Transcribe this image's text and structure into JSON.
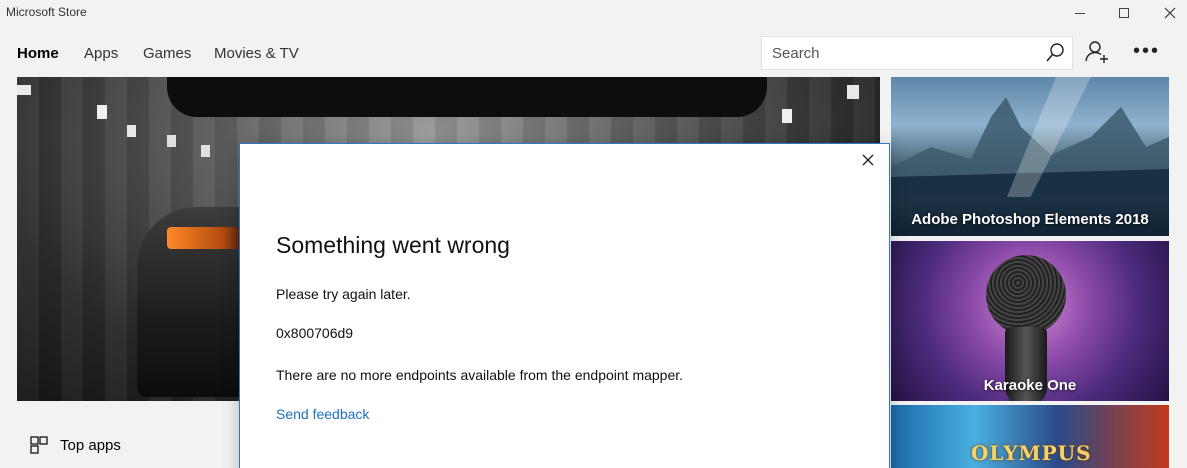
{
  "window": {
    "title": "Microsoft Store"
  },
  "nav": {
    "items": [
      {
        "label": "Home",
        "active": true
      },
      {
        "label": "Apps",
        "active": false
      },
      {
        "label": "Games",
        "active": false
      },
      {
        "label": "Movies & TV",
        "active": false
      }
    ],
    "search_placeholder": "Search",
    "search_value": "",
    "icons": [
      "search-icon",
      "account-add-icon",
      "more-icon"
    ]
  },
  "content": {
    "tiles": [
      {
        "label": "Adobe Photoshop Elements 2018"
      },
      {
        "label": "Karaoke One"
      },
      {
        "label": "OLYMPUS"
      }
    ],
    "section_label": "Top apps"
  },
  "dialog": {
    "title": "Something went wrong",
    "message": "Please try again later.",
    "error_code": "0x800706d9",
    "detail": "There are no more endpoints available from the endpoint mapper.",
    "link": "Send feedback"
  },
  "colors": {
    "accent": "#2b79c8",
    "link": "#1f6fc0",
    "chrome": "#f2f2f2"
  }
}
